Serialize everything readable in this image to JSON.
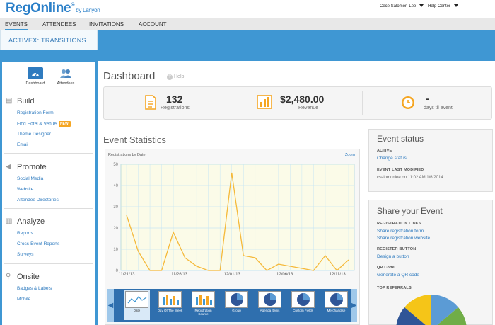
{
  "brand": {
    "name": "RegOnline",
    "reg": "®",
    "by": "by Lanyon"
  },
  "header": {
    "user": "Cece Salomon-Lee",
    "help": "Help Center"
  },
  "nav": {
    "items": [
      "EVENTS",
      "ATTENDEES",
      "INVITATIONS",
      "ACCOUNT"
    ],
    "active": "EVENTS"
  },
  "event": {
    "name": "ACTIVEX: TRANSITIONS"
  },
  "sidebar": {
    "tiles": [
      {
        "label": "Dashboard",
        "icon": "dashboard-icon"
      },
      {
        "label": "Attendees",
        "icon": "attendees-icon"
      }
    ],
    "sections": [
      {
        "title": "Build",
        "icon": "document-icon",
        "links": [
          "Registration Form",
          "Find Hotel & Venue",
          "Theme Designer",
          "Email"
        ],
        "badge": "NEW!"
      },
      {
        "title": "Promote",
        "icon": "megaphone-icon",
        "links": [
          "Social Media",
          "Website",
          "Attendee Directories"
        ]
      },
      {
        "title": "Analyze",
        "icon": "chart-icon",
        "links": [
          "Reports",
          "Cross-Event Reports",
          "Surveys"
        ]
      },
      {
        "title": "Onsite",
        "icon": "location-pin-icon",
        "links": [
          "Badges & Labels",
          "Mobile"
        ]
      }
    ]
  },
  "dashboard": {
    "title": "Dashboard",
    "help": "Help",
    "stats": [
      {
        "value": "132",
        "label": "Registrations",
        "icon": "document-icon"
      },
      {
        "value": "$2,480.00",
        "label": "Revenue",
        "icon": "bar-chart-icon"
      },
      {
        "value": "-",
        "label": "days til event",
        "icon": "clock-icon"
      }
    ]
  },
  "event_statistics": {
    "title": "Event Statistics",
    "caption": "Registrations by Date",
    "zoom": "Zoom",
    "thumbnails": [
      "Date",
      "Day Of The Week",
      "Registration Source",
      "Group",
      "Agenda Items",
      "Custom Fields",
      "Merchandise"
    ]
  },
  "chart_data": {
    "type": "line",
    "x": [
      "11/21/13",
      "11/23/13",
      "11/25/13",
      "11/27/13",
      "11/29/13",
      "12/01/13",
      "12/03/13",
      "12/05/13",
      "12/07/13",
      "12/09/13",
      "12/11/13",
      "12/13/13"
    ],
    "x_ticks": [
      "11/21/13",
      "11/26/13",
      "12/01/13",
      "12/06/13",
      "12/11/13"
    ],
    "y_ticks": [
      0,
      10,
      20,
      30,
      40,
      50
    ],
    "ylim": [
      0,
      50
    ],
    "values": [
      26,
      9,
      0,
      0,
      18,
      6,
      2,
      0,
      0,
      46,
      7,
      6,
      0,
      3,
      2,
      1,
      0,
      7,
      0,
      5
    ],
    "x_index_note_free": true,
    "grid": true,
    "colors": {
      "line": "#f5b93a",
      "plot_bg": "#fbfbe8",
      "grid": "#c7e6f5"
    }
  },
  "status": {
    "title": "Event status",
    "active_label": "ACTIVE",
    "active_link": "Change status",
    "modified_label": "EVENT LAST MODIFIED",
    "modified_text": "csalomonlee on 11:02 AM 1/6/2014"
  },
  "share": {
    "title": "Share your Event",
    "reg_links_label": "REGISTRATION LINKS",
    "reg_links": [
      "Share registration form",
      "Share registration website"
    ],
    "button_label": "REGISTER BUTTON",
    "button_link": "Design a button",
    "qr_label": "QR Code",
    "qr_link": "Generate a QR code",
    "referrals_label": "TOP REFERRALS"
  },
  "colors": {
    "accent": "#3f97d3",
    "link": "#2f7bbf",
    "orange": "#f5a623"
  }
}
